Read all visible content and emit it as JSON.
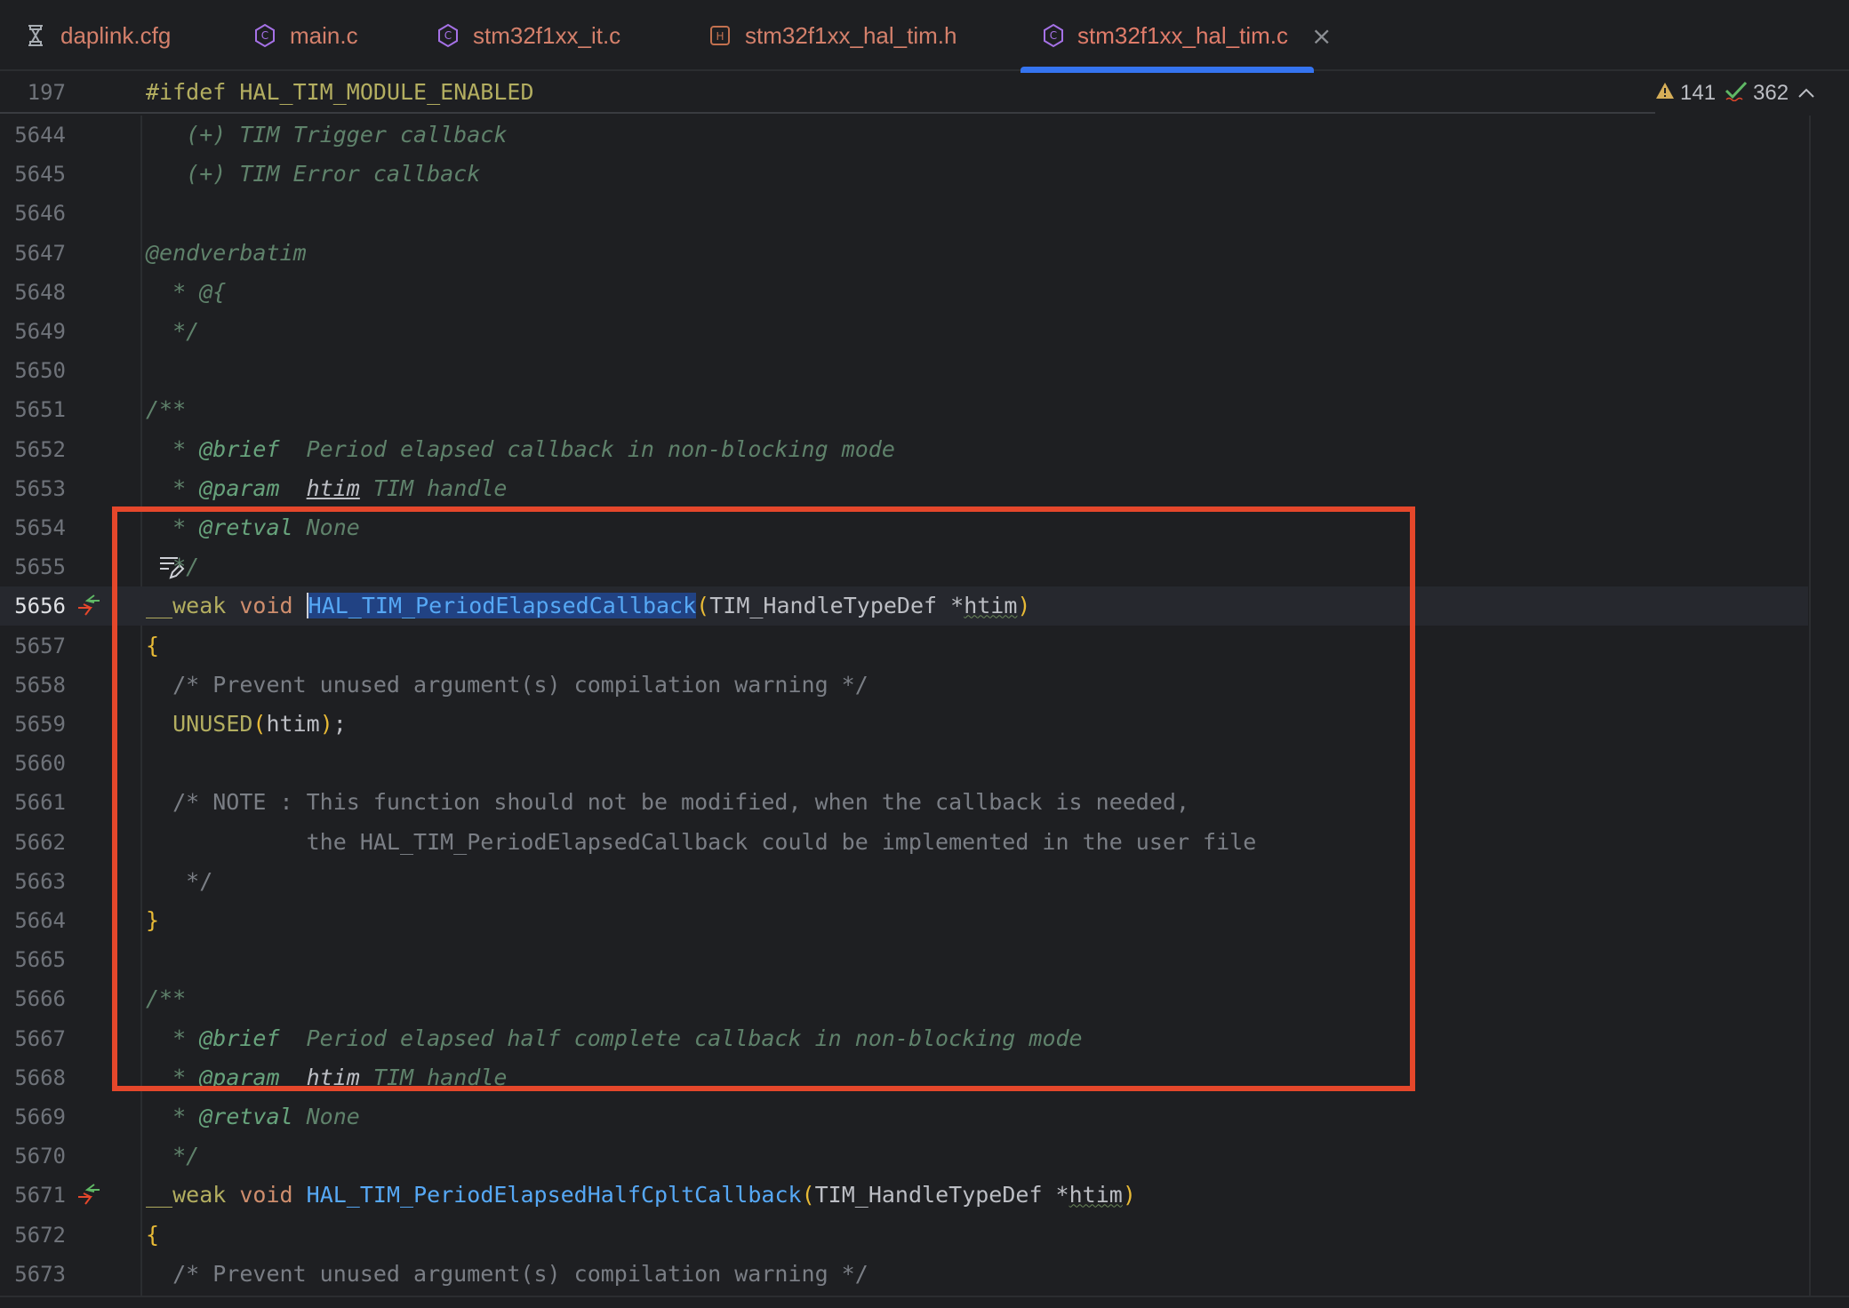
{
  "tabs": [
    {
      "label": "daplink.cfg",
      "icon": "config-file-icon",
      "active": false
    },
    {
      "label": "main.c",
      "icon": "c-file-icon",
      "active": false
    },
    {
      "label": "stm32f1xx_it.c",
      "icon": "c-file-icon",
      "active": false
    },
    {
      "label": "stm32f1xx_hal_tim.h",
      "icon": "header-file-icon",
      "active": false
    },
    {
      "label": "stm32f1xx_hal_tim.c",
      "icon": "c-file-icon",
      "active": true
    }
  ],
  "close_glyph": "×",
  "sticky": {
    "line": "197",
    "directive": "#ifdef",
    "macro": "HAL_TIM_MODULE_ENABLED"
  },
  "inspections": {
    "warnings": "141",
    "ok": "362"
  },
  "lines": [
    {
      "n": "5644",
      "segs": [
        [
          "c-doc",
          "   (+) TIM Trigger callback"
        ]
      ]
    },
    {
      "n": "5645",
      "segs": [
        [
          "c-doc",
          "   (+) TIM Error callback"
        ]
      ]
    },
    {
      "n": "5646",
      "segs": []
    },
    {
      "n": "5647",
      "segs": [
        [
          "c-doc",
          "@endverbatim"
        ]
      ]
    },
    {
      "n": "5648",
      "segs": [
        [
          "c-doc",
          "  * @{"
        ]
      ]
    },
    {
      "n": "5649",
      "segs": [
        [
          "c-doc",
          "  */"
        ]
      ]
    },
    {
      "n": "5650",
      "segs": []
    },
    {
      "n": "5651",
      "segs": [
        [
          "c-doc",
          "/**"
        ]
      ]
    },
    {
      "n": "5652",
      "segs": [
        [
          "c-doc",
          "  * "
        ],
        [
          "c-tag",
          "@brief"
        ],
        [
          "c-doc",
          "  Period elapsed callback in non-blocking mode"
        ]
      ]
    },
    {
      "n": "5653",
      "segs": [
        [
          "c-doc",
          "  * "
        ],
        [
          "c-tag",
          "@param"
        ],
        [
          "c-doc",
          "  "
        ],
        [
          "c-under",
          "htim"
        ],
        [
          "c-doc",
          " TIM handle"
        ]
      ]
    },
    {
      "n": "5654",
      "segs": [
        [
          "c-doc",
          "  * "
        ],
        [
          "c-tag",
          "@retval"
        ],
        [
          "c-doc",
          " None"
        ]
      ]
    },
    {
      "n": "5655",
      "segs": [
        [
          "c-doc",
          "  */"
        ]
      ],
      "reader": true
    },
    {
      "n": "5656",
      "current": true,
      "gutter": "implements",
      "segs": [
        [
          "c-macro",
          "__weak"
        ],
        [
          "c-plain",
          " "
        ],
        [
          "c-kw",
          "void"
        ],
        [
          "c-plain",
          " "
        ],
        [
          "c-fn sel caret",
          "HAL_TIM_PeriodElapsedCallback"
        ],
        [
          "c-brace",
          "("
        ],
        [
          "c-plain",
          "TIM_HandleTypeDef *"
        ],
        [
          "c-param",
          "htim"
        ],
        [
          "c-brace",
          ")"
        ]
      ]
    },
    {
      "n": "5657",
      "segs": [
        [
          "c-brace",
          "{"
        ]
      ]
    },
    {
      "n": "5658",
      "segs": [
        [
          "c-plain-cmt",
          "  /* Prevent unused argument(s) compilation warning */"
        ]
      ]
    },
    {
      "n": "5659",
      "segs": [
        [
          "c-plain",
          "  "
        ],
        [
          "c-macro",
          "UNUSED"
        ],
        [
          "c-brace",
          "("
        ],
        [
          "c-plain",
          "htim"
        ],
        [
          "c-brace",
          ")"
        ],
        [
          "c-plain",
          ";"
        ]
      ]
    },
    {
      "n": "5660",
      "segs": []
    },
    {
      "n": "5661",
      "segs": [
        [
          "c-plain-cmt",
          "  /* NOTE : This function should not be modified, when the callback is needed,"
        ]
      ]
    },
    {
      "n": "5662",
      "segs": [
        [
          "c-plain-cmt",
          "            the HAL_TIM_PeriodElapsedCallback could be implemented in the user file"
        ]
      ]
    },
    {
      "n": "5663",
      "segs": [
        [
          "c-plain-cmt",
          "   */"
        ]
      ]
    },
    {
      "n": "5664",
      "segs": [
        [
          "c-brace",
          "}"
        ]
      ]
    },
    {
      "n": "5665",
      "segs": []
    },
    {
      "n": "5666",
      "segs": [
        [
          "c-doc",
          "/**"
        ]
      ]
    },
    {
      "n": "5667",
      "segs": [
        [
          "c-doc",
          "  * "
        ],
        [
          "c-tag",
          "@brief"
        ],
        [
          "c-doc",
          "  Period elapsed half complete callback in non-blocking mode"
        ]
      ]
    },
    {
      "n": "5668",
      "segs": [
        [
          "c-doc",
          "  * "
        ],
        [
          "c-tag",
          "@param"
        ],
        [
          "c-doc",
          "  "
        ],
        [
          "c-under",
          "htim"
        ],
        [
          "c-doc",
          " TIM handle"
        ]
      ]
    },
    {
      "n": "5669",
      "segs": [
        [
          "c-doc",
          "  * "
        ],
        [
          "c-tag",
          "@retval"
        ],
        [
          "c-doc",
          " None"
        ]
      ]
    },
    {
      "n": "5670",
      "segs": [
        [
          "c-doc",
          "  */"
        ]
      ]
    },
    {
      "n": "5671",
      "gutter": "implements",
      "segs": [
        [
          "c-macro",
          "__weak"
        ],
        [
          "c-plain",
          " "
        ],
        [
          "c-kw",
          "void"
        ],
        [
          "c-plain",
          " "
        ],
        [
          "c-fn",
          "HAL_TIM_PeriodElapsedHalfCpltCallback"
        ],
        [
          "c-brace",
          "("
        ],
        [
          "c-plain",
          "TIM_HandleTypeDef *"
        ],
        [
          "c-param",
          "htim"
        ],
        [
          "c-brace",
          ")"
        ]
      ]
    },
    {
      "n": "5672",
      "segs": [
        [
          "c-brace",
          "{"
        ]
      ]
    },
    {
      "n": "5673",
      "segs": [
        [
          "c-plain-cmt",
          "  /* Prevent unused argument(s) compilation warning */"
        ]
      ]
    }
  ]
}
